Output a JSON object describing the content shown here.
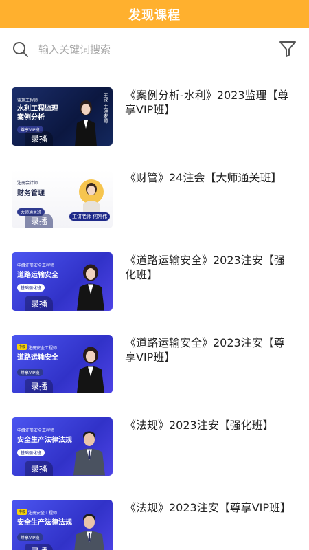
{
  "header": {
    "title": "发现课程"
  },
  "search": {
    "placeholder": "输入关键词搜索"
  },
  "courses": [
    {
      "title": "《案例分析-水利》2023监理【尊享VIP班】",
      "thumb": {
        "top_label": "监理工程师",
        "line1": "水利工程监理",
        "line2": "案例分析",
        "pill": "尊享VIP班",
        "badge": "录播",
        "side": "王欣 主讲老师"
      }
    },
    {
      "title": "《财管》24注会【大师通关班】",
      "thumb": {
        "top_label": "注册会计师",
        "line1": "财务管理",
        "pill": "大师通关班",
        "badge": "录播",
        "name_tag": "主讲老师 何常伟"
      }
    },
    {
      "title": "《道路运输安全》2023注安【强化班】",
      "thumb": {
        "top_label": "中级注册安全工程师",
        "line1": "道路运输安全",
        "pill": "基础强化班",
        "badge": "录播"
      }
    },
    {
      "title": "《道路运输安全》2023注安【尊享VIP班】",
      "thumb": {
        "tag": "中级",
        "top_label": "注册安全工程师",
        "line1": "道路运输安全",
        "pill": "尊享VIP班",
        "badge": "录播"
      }
    },
    {
      "title": "《法规》2023注安【强化班】",
      "thumb": {
        "top_label": "中级注册安全工程师",
        "line1": "安全生产法律法规",
        "pill": "基础强化班",
        "badge": "录播"
      }
    },
    {
      "title": "《法规》2023注安【尊享VIP班】",
      "thumb": {
        "tag": "中级",
        "top_label": "注册安全工程师",
        "line1": "安全生产法律法规",
        "pill": "尊享VIP班",
        "badge": "录播"
      }
    }
  ],
  "colors": {
    "header_bg": "#ffb02e",
    "header_text": "#ffffff",
    "thumb_blue": "#3f45e0",
    "thumb_dark": "#13245a"
  },
  "icons": {
    "search": "search-icon",
    "filter": "filter-icon"
  }
}
